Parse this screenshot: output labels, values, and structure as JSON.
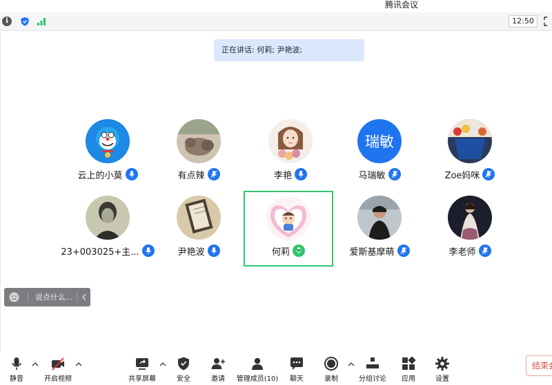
{
  "window": {
    "title": "腾讯会议"
  },
  "status": {
    "time": "12:50"
  },
  "speaking": {
    "text": "正在讲话: 何莉; 尹艳波;"
  },
  "participants": [
    {
      "name": "云上的小莫",
      "mic": "muted-blue"
    },
    {
      "name": "有点辣",
      "mic": "muted-blue"
    },
    {
      "name": "李艳",
      "mic": "muted-blue"
    },
    {
      "name": "马瑞敏",
      "mic": "muted-blue",
      "avatar_text": "瑞敏"
    },
    {
      "name": "Zoe妈咪",
      "mic": "muted-blue"
    },
    {
      "name": "23+003025+主...",
      "mic": "muted-blue"
    },
    {
      "name": "尹艳波",
      "mic": "muted-blue"
    },
    {
      "name": "何莉",
      "mic": "speaking-green"
    },
    {
      "name": "爱斯基摩萌",
      "mic": "muted-blue"
    },
    {
      "name": "李老师",
      "mic": "muted-blue"
    }
  ],
  "chat": {
    "placeholder": "说点什么..."
  },
  "toolbar": {
    "mute": "静音",
    "video": "开启视频",
    "share": "共享屏幕",
    "security": "安全",
    "invite": "邀请",
    "members": "管理成员(10)",
    "chat": "聊天",
    "record": "录制",
    "breakout": "分组讨论",
    "apps": "应用",
    "settings": "设置",
    "end": "结束会议"
  },
  "colors": {
    "accent": "#1f75f0",
    "active_speaker": "#2fc56a",
    "end": "#e04848"
  }
}
